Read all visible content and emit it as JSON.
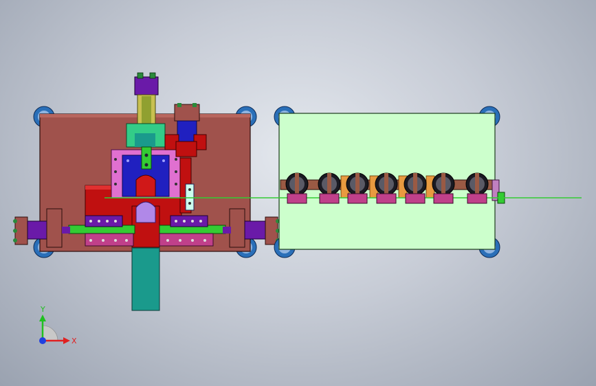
{
  "scene": {
    "background_top": "#e6e9ee",
    "background_bottom": "#9aa2b0"
  },
  "colors": {
    "base_plate": "#a0524c",
    "feed_plate": "#ccffcc",
    "cylinder": "#6a1aa8",
    "green": "#33cc33",
    "teal": "#1a9a8c",
    "pink": "#e070d0",
    "blue": "#2020c0",
    "red": "#c01010",
    "foot": "#2a6fb8",
    "copper": "#e89a40"
  },
  "triad": {
    "x_label": "X",
    "y_label": "Y",
    "x_color": "#e02020",
    "y_color": "#20c020",
    "z_color": "#2040e0"
  }
}
